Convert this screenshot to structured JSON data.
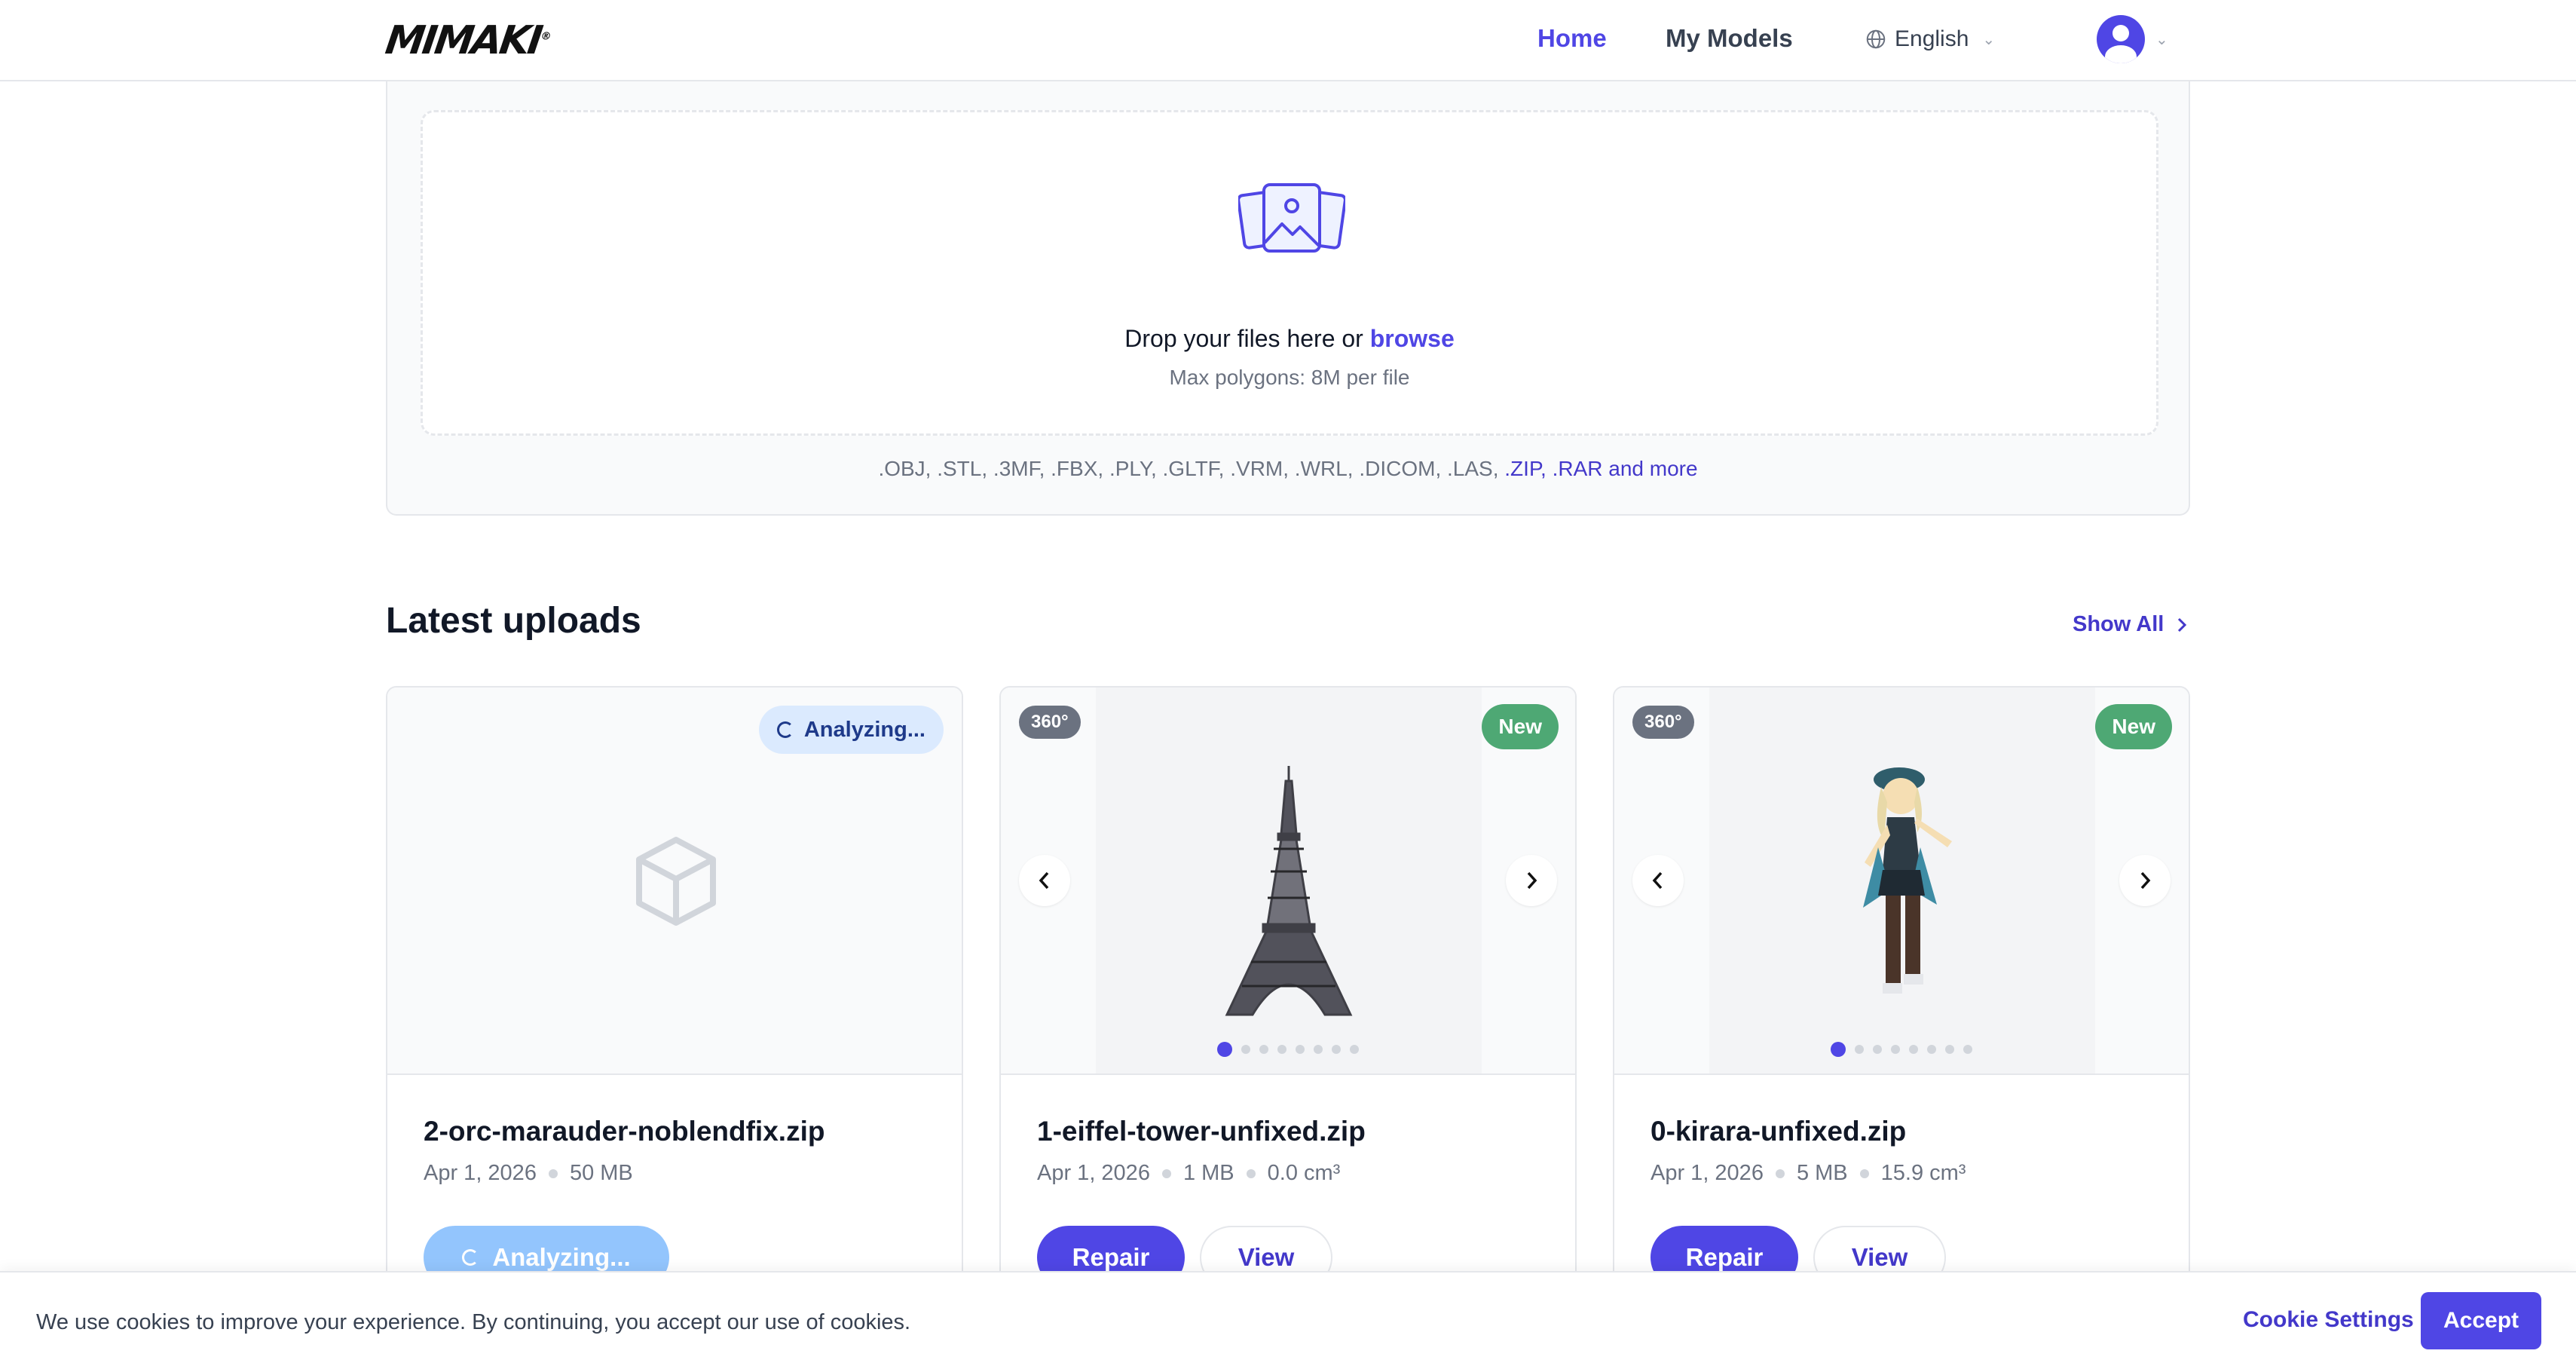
{
  "brand": {
    "logo_text": "MIMAKI"
  },
  "nav": {
    "home": "Home",
    "my_models": "My Models",
    "language": "English"
  },
  "colors": {
    "accent": "#4f46e5",
    "new_badge": "#4ea874",
    "analyzing_bg": "#dbeafe"
  },
  "upload": {
    "drop_text": "Drop your files here or",
    "browse": "browse",
    "max_polygons": "Max polygons: 8M per file",
    "formats_plain": ".OBJ, .STL, .3MF, .FBX, .PLY, .GLTF, .VRM, .WRL, .DICOM, .LAS,",
    "formats_highlight": ".ZIP, .RAR and more"
  },
  "latest": {
    "title": "Latest uploads",
    "show_all": "Show All",
    "cards": [
      {
        "name": "2-orc-marauder-noblendfix.zip",
        "date": "Apr 1, 2026",
        "size": "50 MB",
        "status_badge": "Analyzing...",
        "button_label": "Analyzing...",
        "thumbnail_icon": "cube-icon"
      },
      {
        "name": "1-eiffel-tower-unfixed.zip",
        "date": "Apr 1, 2026",
        "size": "1 MB",
        "volume": "0.0 cm³",
        "badge_360": "360°",
        "badge_new": "New",
        "repair": "Repair",
        "view": "View",
        "thumbnail": "eiffel-tower-model",
        "slides": 8,
        "active_slide": 1
      },
      {
        "name": "0-kirara-unfixed.zip",
        "date": "Apr 1, 2026",
        "size": "5 MB",
        "volume": "15.9 cm³",
        "badge_360": "360°",
        "badge_new": "New",
        "repair": "Repair",
        "view": "View",
        "thumbnail": "character-model",
        "slides": 8,
        "active_slide": 1
      }
    ]
  },
  "cookie": {
    "text": "We use cookies to improve your experience. By continuing, you accept our use of cookies.",
    "settings": "Cookie Settings",
    "accept": "Accept"
  }
}
